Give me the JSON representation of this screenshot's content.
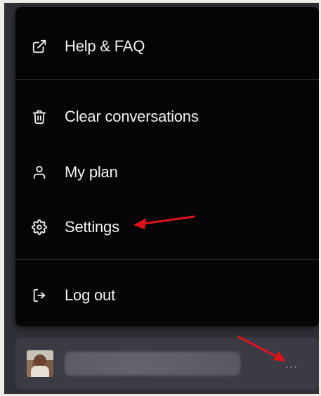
{
  "menu": {
    "items": [
      {
        "label": "Help & FAQ",
        "icon": "external-link-icon"
      },
      {
        "label": "Clear conversations",
        "icon": "trash-icon"
      },
      {
        "label": "My plan",
        "icon": "user-icon"
      },
      {
        "label": "Settings",
        "icon": "gear-icon"
      },
      {
        "label": "Log out",
        "icon": "logout-icon"
      }
    ]
  },
  "user_bar": {
    "more_label": "..."
  },
  "colors": {
    "menu_bg": "#050507",
    "text": "#f2f2f3",
    "annotation_arrow": "#e0111b"
  }
}
